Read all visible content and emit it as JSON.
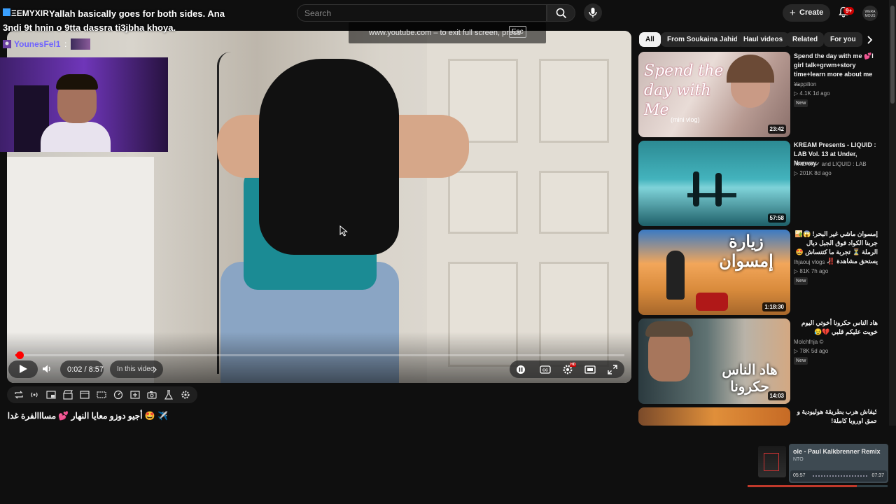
{
  "overlay_chat": {
    "user_tag": "ΞEMYXIR",
    "line1": "Yallah basically goes for both sides. Ana",
    "line2": "3ndi 9t hnin o 9tta dassra ti3jbha khoya.",
    "second_user": "YounesFel1",
    "second_sep": ":"
  },
  "header": {
    "search_placeholder": "Search",
    "create_label": "Create",
    "notification_count": "9+",
    "avatar_text": "WERA MOUS"
  },
  "player": {
    "fullscreen_hint": "www.youtube.com – to exit full screen, press",
    "esc_key": "Esc",
    "current_time": "0:02",
    "duration": "8:57",
    "time_display": "0:02 / 8:57",
    "chapter_label": "In this video",
    "progress_fraction": 0.004,
    "hd_badge": "HD"
  },
  "caption": "✈️ 🤩 أجيو دوزو معايا النهار 💕 مسااالفرة غدا",
  "chips": [
    "All",
    "From Soukaina Jahid",
    "Haul videos",
    "Related",
    "For you"
  ],
  "recommendations": [
    {
      "title": "Spend the day with me 💕l girl talk+grwm+story time+learn more about me ...",
      "channel": "Yappilion",
      "meta": "▷ 4.1K   1d ago",
      "badge": "New",
      "duration": "23:42",
      "rtl": false
    },
    {
      "title": "KREAM Presents - LIQUID : LAB Vol. 13 at Under, Norway",
      "channel": "KREAM ✔ and LIQUID : LAB",
      "meta": "▷ 201K   8d ago",
      "badge": "",
      "duration": "57:58",
      "rtl": false
    },
    {
      "title": "إمسوان ماشي غير البحر! 😱🏜️ جربنا الكواد فوق الجبل ديال الرملة ⏳ تجربة ما كتنساش 🤩يستحق مشاهدة ‼️",
      "channel": "Ihjaouj vlogs ✔",
      "meta": "▷ 81K   7h ago",
      "badge": "New",
      "duration": "1:18:30",
      "rtl": true
    },
    {
      "title": "هاد الناس حكرونا أخوتي اليوم خويت عليكم قلبي 💔😥",
      "channel": "Molchfnja ©",
      "meta": "▷ 78K   5d ago",
      "badge": "New",
      "duration": "14:03",
      "rtl": true
    },
    {
      "title": "كيفاش هرب بطريقة هوليودية و حمق اوروبا كاملة!",
      "channel": "",
      "meta": "",
      "badge": "",
      "duration": "",
      "rtl": true
    }
  ],
  "thumb_text": {
    "rec0": "Spend the day with Me",
    "rec0_small": "(mini vlog)",
    "rec2": "زيارة إمسوان",
    "rec3": "هاد الناس حكرونا"
  },
  "mini_player": {
    "title": "ole - Paul Kalkbrenner Remix",
    "subtitle": "NTO",
    "elapsed": "05:57",
    "total": "07:37",
    "progress_fraction": 0.78
  },
  "colors": {
    "accent_red": "#ff0000",
    "background": "#0f0f0f",
    "chip_bg": "#272727"
  }
}
